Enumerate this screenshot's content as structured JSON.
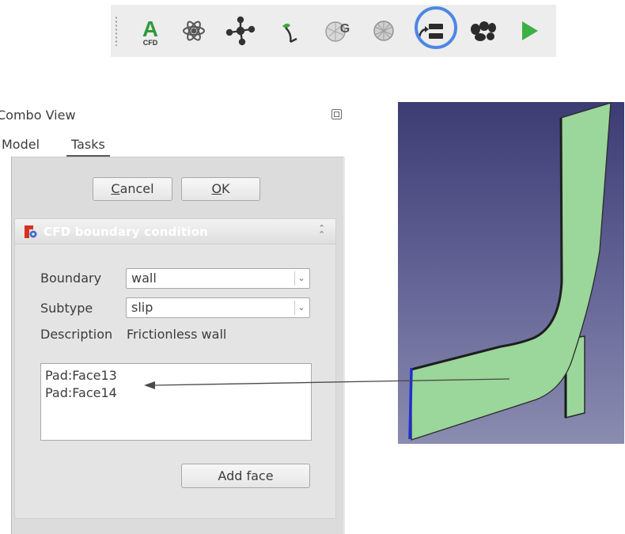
{
  "toolbar": {
    "icons": [
      {
        "name": "cfd-workbench-icon",
        "badge": "CFD",
        "letter": "A"
      },
      {
        "name": "physics-model-icon"
      },
      {
        "name": "fluid-material-icon"
      },
      {
        "name": "initialise-internal-icon"
      },
      {
        "name": "mesh-gmsh-icon",
        "letter": "G"
      },
      {
        "name": "mesh-region-icon"
      },
      {
        "name": "fluid-boundary-icon"
      },
      {
        "name": "dynamic-mesh-icon"
      },
      {
        "name": "solver-run-icon"
      }
    ],
    "highlight_color": "#4e86e4"
  },
  "combo_view": {
    "title": "Combo View",
    "tabs": [
      "Model",
      "Tasks"
    ],
    "active_tab": "Tasks"
  },
  "task": {
    "cancel_label": "Cancel",
    "cancel_mnemonic": "C",
    "cancel_rest": "ancel",
    "ok_label": "OK",
    "ok_mnemonic": "O",
    "ok_rest": "K",
    "header": "CFD boundary condition",
    "boundary_label": "Boundary",
    "boundary_value": "wall",
    "subtype_label": "Subtype",
    "subtype_value": "slip",
    "description_label": "Description",
    "description_value": "Frictionless wall",
    "faces": [
      "Pad:Face13",
      "Pad:Face14"
    ],
    "add_face_label": "Add face"
  },
  "viewport": {
    "background_top": "#3c3c74",
    "background_bottom": "#8a8cb0",
    "face_color": "#9bd69b",
    "selected_edge_color": "#1f2fd0"
  }
}
